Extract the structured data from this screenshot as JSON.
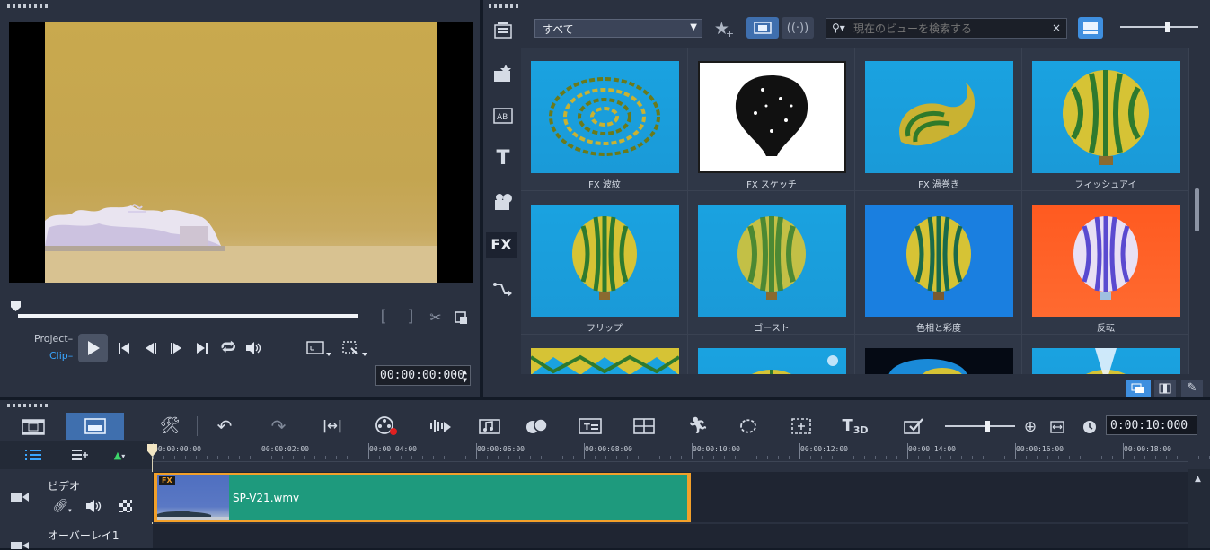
{
  "player": {
    "project_label": "Project",
    "clip_label": "Clip",
    "timecode": "00:00:00:000"
  },
  "library": {
    "category": "すべて",
    "search_placeholder": "現在のビューを検索する",
    "sidebar": [
      "media",
      "instant-project",
      "transition",
      "title",
      "graphic",
      "filter",
      "path"
    ],
    "active_sidebar": "filter",
    "items": [
      {
        "label": "FX 波紋",
        "kind": "ripple"
      },
      {
        "label": "FX スケッチ",
        "kind": "sketch"
      },
      {
        "label": "FX 渦巻き",
        "kind": "swirl"
      },
      {
        "label": "フィッシュアイ",
        "kind": "fisheye"
      },
      {
        "label": "フリップ",
        "kind": "flip"
      },
      {
        "label": "ゴースト",
        "kind": "ghost"
      },
      {
        "label": "色相と彩度",
        "kind": "hue"
      },
      {
        "label": "反転",
        "kind": "invert"
      },
      {
        "label": "",
        "kind": "kaleido"
      },
      {
        "label": "",
        "kind": "lens1"
      },
      {
        "label": "",
        "kind": "dark"
      },
      {
        "label": "",
        "kind": "light"
      }
    ]
  },
  "timeline": {
    "timecode": "0:00:10:000",
    "ruler": [
      "00:00:00:00",
      "00:00:02:00",
      "00:00:04:00",
      "00:00:06:00",
      "00:00:08:00",
      "00:00:10:00",
      "00:00:12:00",
      "00:00:14:00",
      "00:00:16:00",
      "00:00:18:00"
    ],
    "tracks": [
      {
        "name": "ビデオ"
      },
      {
        "name": "オーバーレイ1"
      }
    ],
    "clip": {
      "name": "SP-V21.wmv",
      "fx_badge": "FX"
    }
  }
}
